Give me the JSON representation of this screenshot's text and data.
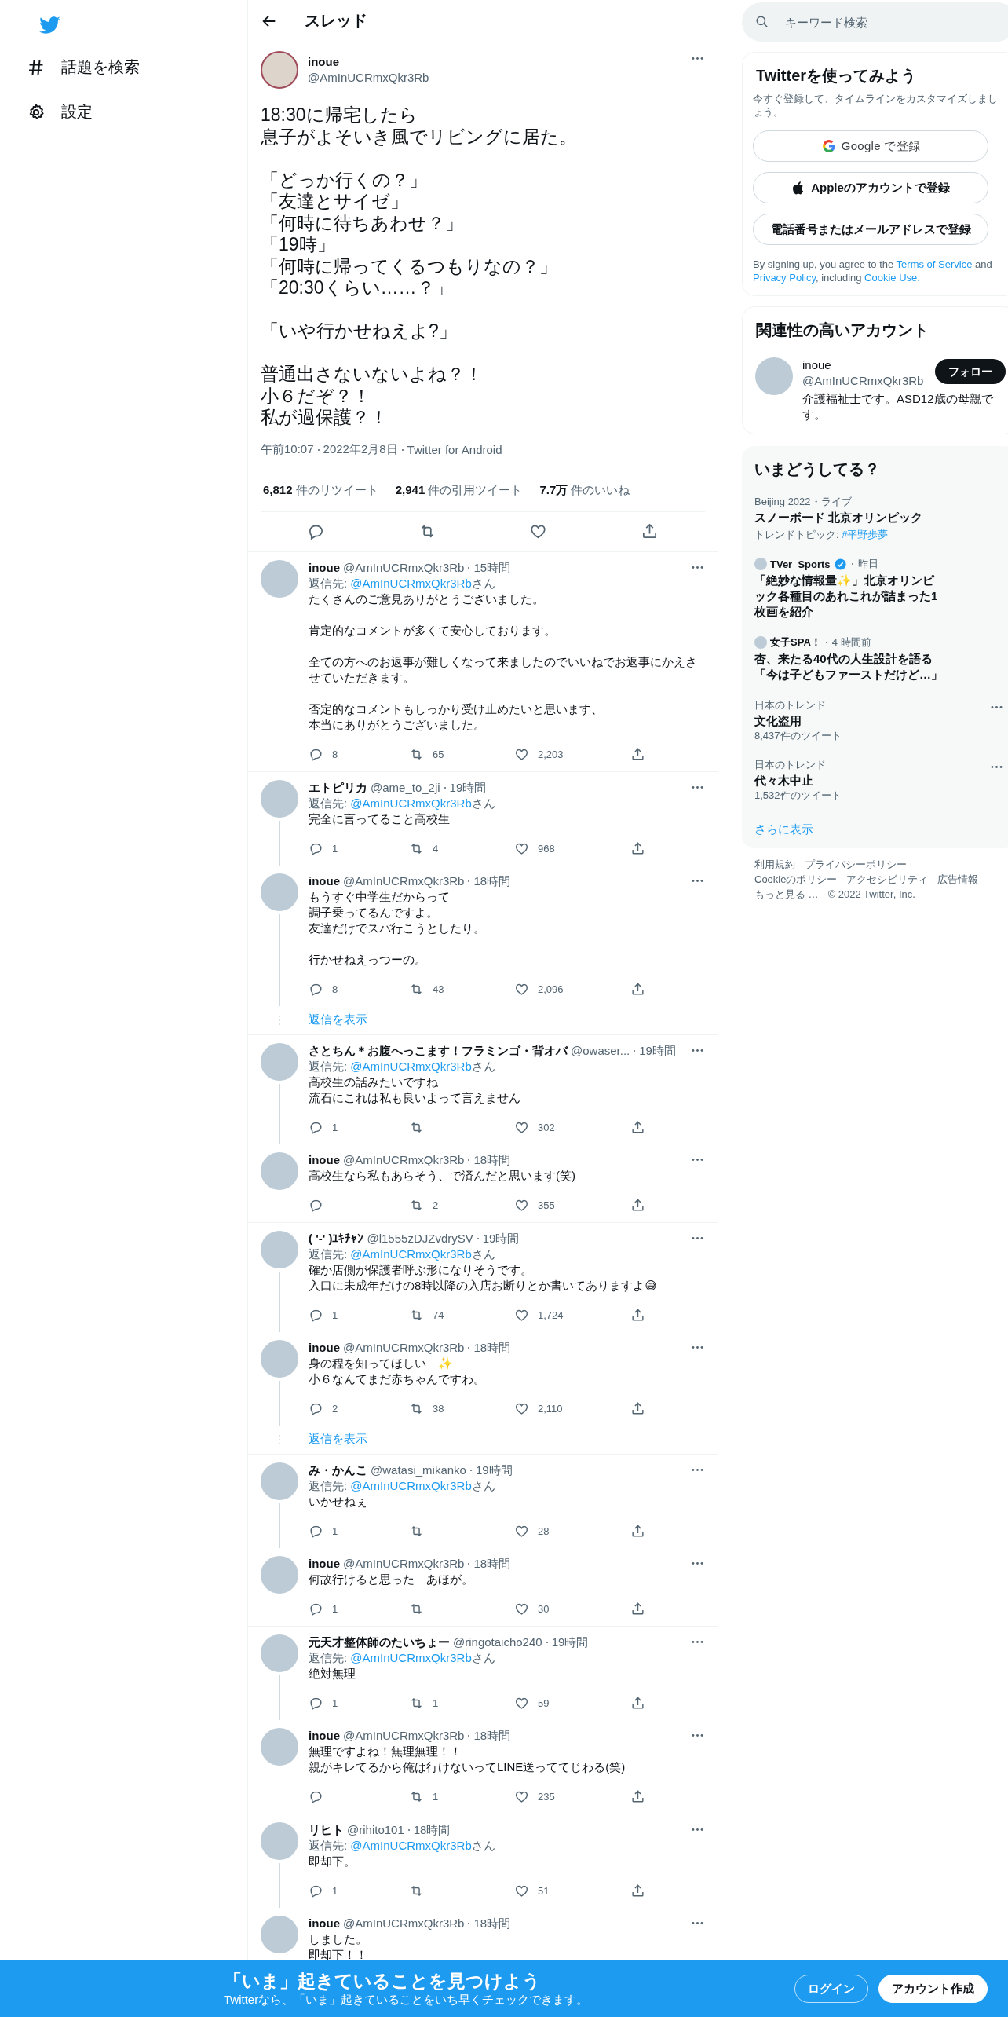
{
  "nav": {
    "items": [
      {
        "label": "話題を検索"
      },
      {
        "label": "設定"
      }
    ]
  },
  "header": {
    "title": "スレッド"
  },
  "main_tweet": {
    "name": "inoue",
    "handle": "@AmInUCRmxQkr3Rb",
    "text": [
      [
        "18:30に帰宅したら",
        "息子がよそいき風でリビングに居た。"
      ],
      [
        "「どっか行くの？」",
        "「友達とサイゼ」",
        "「何時に待ちあわせ？」",
        "「19時」",
        "「何時に帰ってくるつもりなの？」",
        "「20:30くらい……？」"
      ],
      [
        "「いや行かせねえよ?」"
      ],
      [
        "普通出さないないよね？！",
        "小６だぞ？！",
        "私が過保護？！"
      ]
    ],
    "time": "午前10:07",
    "date": "2022年2月8日",
    "source": "Twitter for Android",
    "stats": [
      "**6,812** 件のリツイート",
      "**2,941** 件の引用ツイート",
      "**7.7万** 件のいいね"
    ]
  },
  "conversations": [
    {
      "tweets": [
        {
          "name": "inoue",
          "handle": "@AmInUCRmxQkr3Rb",
          "time": "15時間",
          "reply_to": {
            "prefix": "返信先: ",
            "handle": "@AmInUCRmxQkr3Rb",
            "suffix": "さん"
          },
          "text": [
            [
              "たくさんのご意見ありがとうございました。"
            ],
            [
              "肯定的なコメントが多くて安心しております。"
            ],
            [
              "全ての方へのお返事が難しくなって来ましたのでいいねでお返事にかえさせていただきます。"
            ],
            [
              "否定的なコメントもしっかり受け止めたいと思います、",
              "本当にありがとうございました。"
            ]
          ],
          "reply_count": "8",
          "retweet_count": "65",
          "like_count": "2,203"
        }
      ]
    },
    {
      "tweets": [
        {
          "name": "エトピリカ",
          "handle": "@ame_to_2ji",
          "time": "19時間",
          "reply_to": {
            "prefix": "返信先: ",
            "handle": "@AmInUCRmxQkr3Rb",
            "suffix": "さん"
          },
          "text": [
            [
              "完全に言ってること高校生"
            ]
          ],
          "reply_count": "1",
          "retweet_count": "4",
          "like_count": "968"
        },
        {
          "name": "inoue",
          "handle": "@AmInUCRmxQkr3Rb",
          "time": "18時間",
          "text": [
            [
              "もうすぐ中学生だからって",
              "調子乗ってるんですよ。",
              "友達だけでスパ行こうとしたり。"
            ],
            [
              "行かせねえっつーの。"
            ]
          ],
          "reply_count": "8",
          "retweet_count": "43",
          "like_count": "2,096"
        }
      ],
      "show_replies": "返信を表示"
    },
    {
      "tweets": [
        {
          "name": "さとちん＊お腹へっこます！フラミンゴ・背オバ",
          "handle": "@owaser...",
          "time": "19時間",
          "reply_to": {
            "prefix": "返信先: ",
            "handle": "@AmInUCRmxQkr3Rb",
            "suffix": "さん"
          },
          "text": [
            [
              "高校生の話みたいですね",
              "流石にこれは私も良いよって言えません"
            ]
          ],
          "reply_count": "1",
          "like_count": "302"
        },
        {
          "name": "inoue",
          "handle": "@AmInUCRmxQkr3Rb",
          "time": "18時間",
          "text": [
            [
              "高校生なら私もあらそう、で済んだと思います(笑)"
            ]
          ],
          "retweet_count": "2",
          "like_count": "355"
        }
      ]
    },
    {
      "tweets": [
        {
          "name": "( '-'  )ﾕｷﾁｬﾝ",
          "handle": "@l1555zDJZvdrySV",
          "time": "19時間",
          "reply_to": {
            "prefix": "返信先: ",
            "handle": "@AmInUCRmxQkr3Rb",
            "suffix": "さん"
          },
          "text": [
            [
              "確か店側が保護者呼ぶ形になりそうです。",
              "入口に未成年だけの8時以降の入店お断りとか書いてありますよ😅"
            ]
          ],
          "reply_count": "1",
          "retweet_count": "74",
          "like_count": "1,724"
        },
        {
          "name": "inoue",
          "handle": "@AmInUCRmxQkr3Rb",
          "time": "18時間",
          "text": [
            [
              "身の程を知ってほしい　✨",
              "小６なんてまだ赤ちゃんですわ。"
            ]
          ],
          "reply_count": "2",
          "retweet_count": "38",
          "like_count": "2,110"
        }
      ],
      "show_replies": "返信を表示"
    },
    {
      "tweets": [
        {
          "name": "み・かんこ",
          "handle": "@watasi_mikanko",
          "time": "19時間",
          "reply_to": {
            "prefix": "返信先: ",
            "handle": "@AmInUCRmxQkr3Rb",
            "suffix": "さん"
          },
          "text": [
            [
              "いかせねぇ"
            ]
          ],
          "reply_count": "1",
          "like_count": "28"
        },
        {
          "name": "inoue",
          "handle": "@AmInUCRmxQkr3Rb",
          "time": "18時間",
          "text": [
            [
              "何故行けると思った　あほが。"
            ]
          ],
          "reply_count": "1",
          "like_count": "30"
        }
      ]
    },
    {
      "tweets": [
        {
          "name": "元天才整体師のたいちょー",
          "handle": "@ringotaicho240",
          "time": "19時間",
          "reply_to": {
            "prefix": "返信先: ",
            "handle": "@AmInUCRmxQkr3Rb",
            "suffix": "さん"
          },
          "text": [
            [
              "絶対無理"
            ]
          ],
          "reply_count": "1",
          "retweet_count": "1",
          "like_count": "59"
        },
        {
          "name": "inoue",
          "handle": "@AmInUCRmxQkr3Rb",
          "time": "18時間",
          "text": [
            [
              "無理ですよね！無理無理！！",
              "親がキレてるから俺は行けないってLINE送っててじわる(笑)"
            ]
          ],
          "retweet_count": "1",
          "like_count": "235"
        }
      ]
    },
    {
      "tweets": [
        {
          "name": "リヒト",
          "handle": "@rihito101",
          "time": "18時間",
          "reply_to": {
            "prefix": "返信先: ",
            "handle": "@AmInUCRmxQkr3Rb",
            "suffix": "さん"
          },
          "text": [
            [
              "即却下。"
            ]
          ],
          "reply_count": "1",
          "like_count": "51"
        },
        {
          "name": "inoue",
          "handle": "@AmInUCRmxQkr3Rb",
          "time": "18時間",
          "text": [
            [
              "しました。",
              "即却下！！"
            ]
          ]
        }
      ]
    }
  ],
  "sidebar": {
    "search": {
      "placeholder": "キーワード検索"
    },
    "signup": {
      "title": "Twitterを使ってみよう",
      "subtitle": "今すぐ登録して、タイムラインをカスタマイズしましょう。",
      "buttons": [
        {
          "kind": "google",
          "label": "Google で登録"
        },
        {
          "kind": "apple",
          "label": "Appleのアカウントで登録"
        },
        {
          "kind": "plain",
          "label": "電話番号またはメールアドレスで登録"
        }
      ],
      "legal": [
        {
          "text": "By signing up, you agree to the ",
          "link": false
        },
        {
          "text": "Terms of Service",
          "link": true
        },
        {
          "text": " and ",
          "link": false
        },
        {
          "text": "Privacy Policy",
          "link": true
        },
        {
          "text": ", including ",
          "link": false
        },
        {
          "text": "Cookie Use.",
          "link": true
        }
      ]
    },
    "related": {
      "title": "関連性の高いアカウント",
      "account": {
        "name": "inoue",
        "handle": "@AmInUCRmxQkr3Rb",
        "bio": "介護福祉士です。ASD12歳の母親です。",
        "button": "フォロー"
      }
    },
    "trends": {
      "title": "いまどうしてる？",
      "items": [
        {
          "kind": "event",
          "context": "Beijing 2022・ライブ",
          "title": "スノーボード 北京オリンピック",
          "topic_prefix": "トレンドトピック: ",
          "topic": "#平野歩夢"
        },
        {
          "kind": "news",
          "source": "TVer_Sports",
          "verified": true,
          "time": "昨日",
          "title": "「絶妙な情報量✨」北京オリンピック各種目のあれこれが詰まった1枚画を紹介"
        },
        {
          "kind": "news",
          "source": "女子SPA！",
          "verified": false,
          "time": "4 時間前",
          "title": "杏、来たる40代の人生設計を語る「今は子どもファーストだけど…」"
        },
        {
          "kind": "trend",
          "context": "日本のトレンド",
          "title": "文化盗用",
          "count": "8,437件のツイート"
        },
        {
          "kind": "trend",
          "context": "日本のトレンド",
          "title": "代々木中止",
          "count": "1,532件のツイート"
        }
      ],
      "more": "さらに表示"
    },
    "footer": [
      "利用規約",
      "プライバシーポリシー",
      "Cookieのポリシー",
      "アクセシビリティ",
      "広告情報",
      "もっと見る …",
      "© 2022 Twitter, Inc."
    ]
  },
  "banner": {
    "title": "「いま」起きていることを見つけよう",
    "subtitle": "Twitterなら、「いま」起きていることをいち早くチェックできます。",
    "buttons": [
      {
        "kind": "outline",
        "label": "ログイン"
      },
      {
        "kind": "solid",
        "label": "アカウント作成"
      }
    ]
  }
}
